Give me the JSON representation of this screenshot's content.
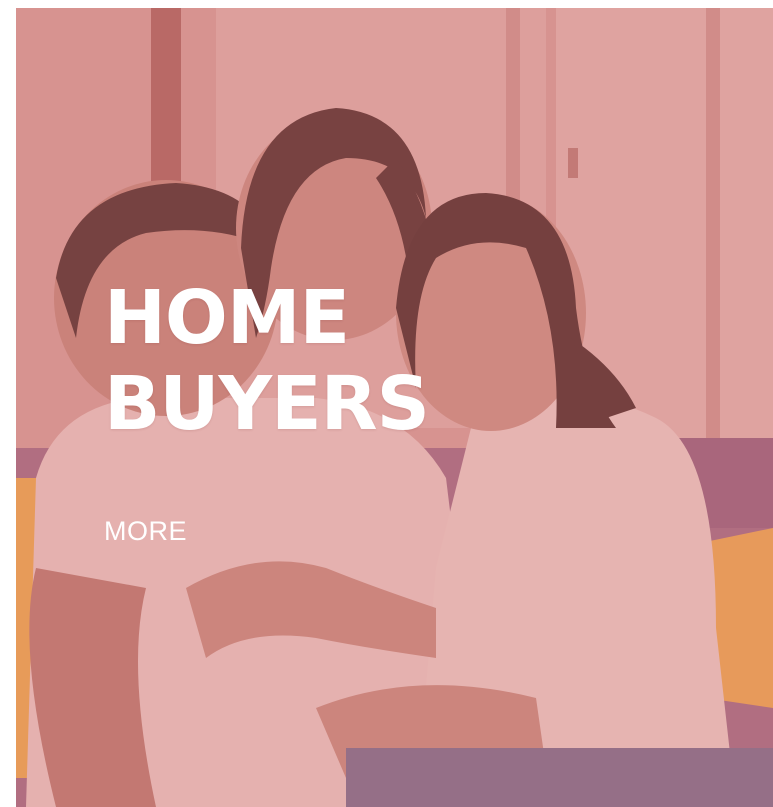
{
  "card": {
    "title_line1": "HOME",
    "title_line2": "BUYERS",
    "more_label": "MORE"
  },
  "colors": {
    "overlay": "#d67674",
    "text": "#ffffff",
    "sofa_yellow": "#f0b048",
    "sofa_purple": "#8a5a7e"
  }
}
